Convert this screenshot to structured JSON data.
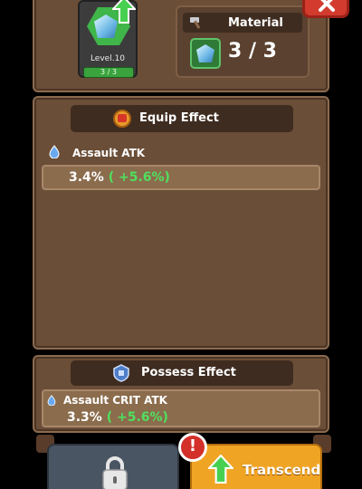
{
  "item": {
    "level": "Level.10",
    "count": "3 / 3",
    "gem_icon": "blue-gem-icon",
    "upgrade_icon": "green-up-arrow-icon"
  },
  "material": {
    "title": "Material",
    "icon": "hammer-icon",
    "quantity": "3 / 3",
    "gem_icon": "blue-gem-icon"
  },
  "close": {
    "icon": "close-x-icon"
  },
  "equip_effect": {
    "title": "Equip Effect",
    "icon": "laurel-badge-icon",
    "stat_icon": "water-drop-icon",
    "stat_name": "Assault ATK",
    "value": "3.4%",
    "bonus": "( +5.6%)"
  },
  "possess_effect": {
    "title": "Possess Effect",
    "icon": "shield-badge-icon",
    "stat_icon": "water-drop-icon",
    "stat_name": "Assault CRIT ATK",
    "value": "3.3%",
    "bonus": "( +5.6%)"
  },
  "buttons": {
    "lock_icon": "padlock-icon",
    "transcend_label": "Transcend",
    "transcend_icon": "green-up-arrow-icon",
    "alert_text": "!"
  },
  "colors": {
    "panel": "#6b4e37",
    "bonus_green": "#4fe05e",
    "transcend_orange": "#f0a424",
    "close_red": "#d23b2e"
  }
}
